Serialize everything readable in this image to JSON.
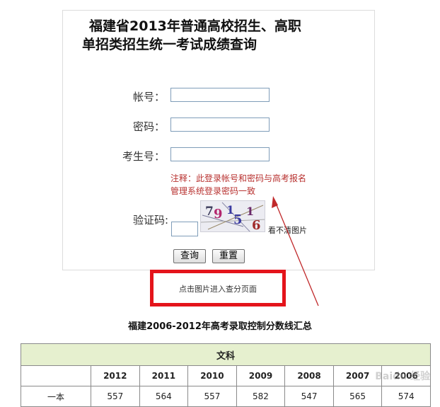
{
  "title": {
    "line1": "福建省2013年普通高校招生、高职",
    "line2": "单招类招生统一考试成绩查询"
  },
  "form": {
    "account_label": "帐号：",
    "password_label": "密码：",
    "exam_no_label": "考生号：",
    "captcha_label": "验证码:",
    "account_value": "",
    "password_value": "",
    "exam_no_value": "",
    "captcha_value": "",
    "note_line1": "注释：此登录帐号和密码与高考报名",
    "note_line2": "管理系统登录密码一致",
    "captcha_chars": [
      "7",
      "9",
      "1",
      "5",
      "1",
      "6"
    ],
    "captcha_refresh": "看不清图片",
    "query_button": "查询",
    "reset_button": "重置"
  },
  "highlight_link": "点击图片进入查分页面",
  "table": {
    "title": "福建2006-2012年高考录取控制分数线汇总",
    "section": "文科",
    "years": [
      "2012",
      "2011",
      "2010",
      "2009",
      "2008",
      "2007",
      "2006"
    ],
    "rows": [
      {
        "label": "一本",
        "values": [
          "557",
          "564",
          "557",
          "582",
          "547",
          "565",
          "574"
        ]
      }
    ]
  },
  "watermark": "Baidu 经验",
  "colors": {
    "note_red": "#b8312f",
    "highlight_border": "#e4141b",
    "table_header_bg": "#e6f0cf"
  }
}
